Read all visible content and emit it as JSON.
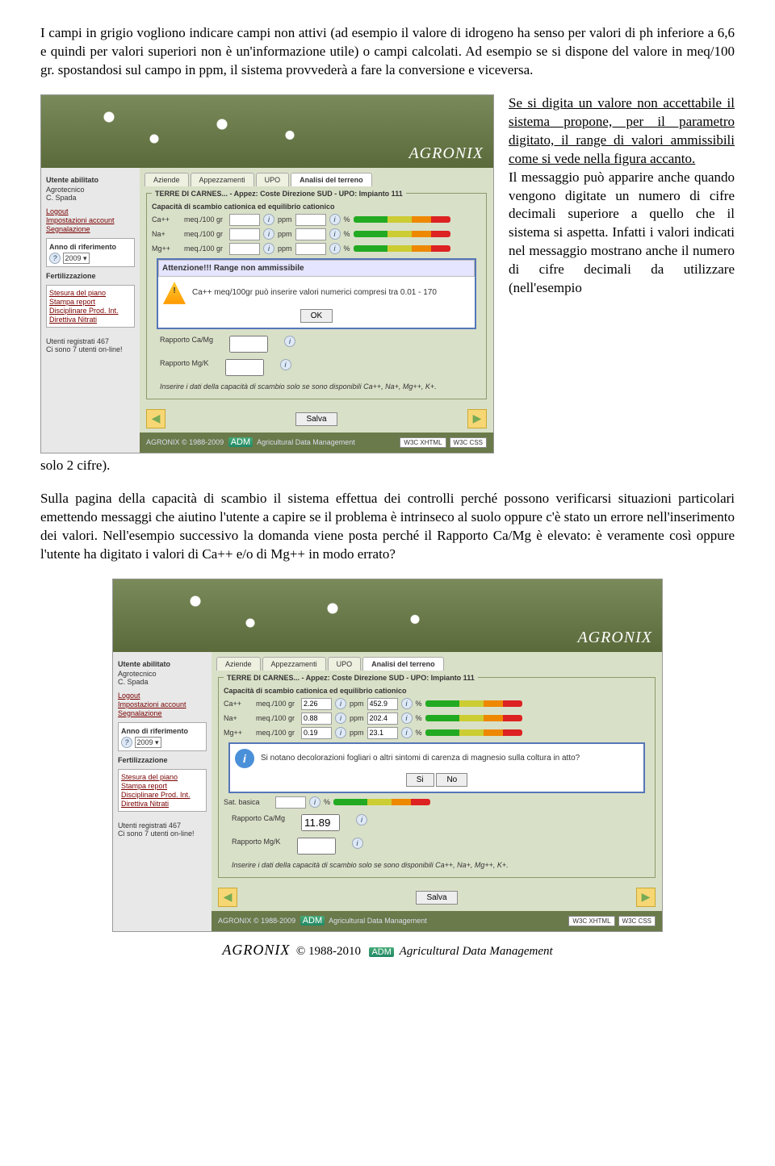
{
  "para1": "I campi in grigio vogliono indicare campi non attivi (ad esempio il valore di idrogeno ha senso per valori di ph inferiore a 6,6 e quindi per valori superiori non è un'informazione utile) o campi calcolati. Ad esempio se si dispone del valore in meq/100 gr. spostandosi sul campo in ppm, il sistema provvederà a fare la conversione e viceversa.",
  "para2a": "Se si digita un valore non accettabile il sistema propone, per il parametro digitato, il range di valori ammissibili come si vede nella figura accanto.",
  "para2b": "Il messaggio può apparire anche quando vengono digitate un numero di cifre decimali superiore a quello che il sistema si aspetta. Infatti i valori indicati nel messaggio mostrano anche il numero di cifre decimali da utilizzare (nell'esempio",
  "para2c": "solo 2 cifre).",
  "para3": "Sulla pagina della capacità di scambio il sistema effettua dei controlli perché possono verificarsi situazioni particolari emettendo messaggi che aiutino l'utente a capire se il problema è intrinseco al suolo oppure c'è stato un errore nell'inserimento dei valori. Nell'esempio successivo la domanda viene posta perché il Rapporto Ca/Mg è elevato: è veramente così oppure l'utente ha digitato i valori di Ca++ e/o di Mg++ in modo errato?",
  "brand": "AGRONIX",
  "side": {
    "h1": "Utente abilitato",
    "h2": "Agrotecnico",
    "h3": "C. Spada",
    "l1": "Logout",
    "l2": "Impostazioni account",
    "l3": "Segnalazione",
    "yh": "Anno di riferimento",
    "yv": "2009",
    "fh": "Fertilizzazione",
    "f1": "Stesura del piano",
    "f2": "Stampa report",
    "f3": "Disciplinare Prod. Int.",
    "f4": "Direttiva Nitrati",
    "u1": "Utenti registrati 467",
    "u2": "Ci sono 7 utenti on-line!"
  },
  "tabs": {
    "t1": "Aziende",
    "t2": "Appezzamenti",
    "t3": "UPO",
    "t4": "Analisi del terreno"
  },
  "bc": "TERRE DI CARNES... - Appez: Coste Direzione SUD - UPO: Impianto 111",
  "leg": "Capacità di scambio cationica ed equilibrio cationico",
  "rows": [
    {
      "l": "Ca++",
      "u": "meq./100 gr"
    },
    {
      "l": "Na+",
      "u": "meq./100 gr"
    },
    {
      "l": "Mg++",
      "u": "meq./100 gr"
    }
  ],
  "rows2": [
    {
      "l": "Ca++",
      "u": "meq./100 gr",
      "v": "2.26",
      "p": "452.9"
    },
    {
      "l": "Na+",
      "u": "meq./100 gr",
      "v": "0.88",
      "p": "202.4"
    },
    {
      "l": "Mg++",
      "u": "meq./100 gr",
      "v": "0.19",
      "p": "23.1"
    }
  ],
  "ppm": "ppm",
  "pct": "%",
  "sat": "Sat. basica",
  "rcmg": "Rapporto Ca/Mg",
  "rmk": "Rapporto Mg/K",
  "rcmgv": "11.89",
  "m1h": "Attenzione!!! Range non ammissibile",
  "m1t": "Ca++ meq/100gr può inserire valori numerici compresi tra 0.01 - 170",
  "ok": "OK",
  "m2t": "Si notano decolorazioni fogliari o altri sintomi di carenza di magnesio sulla coltura in atto?",
  "si": "Si",
  "no": "No",
  "note": "Inserire i dati della capacità di scambio solo se sono disponibili Ca++, Na+, Mg++, K+.",
  "save": "Salva",
  "copy": "AGRONIX  © 1988-2009",
  "adm": "ADM",
  "mgmt": "Agricultural Data Management",
  "b1": "W3C XHTML",
  "b2": "W3C CSS",
  "foot": {
    "a": "AGRONIX",
    "c": "© 1988-2010",
    "m": "Agricultural Data Management"
  }
}
